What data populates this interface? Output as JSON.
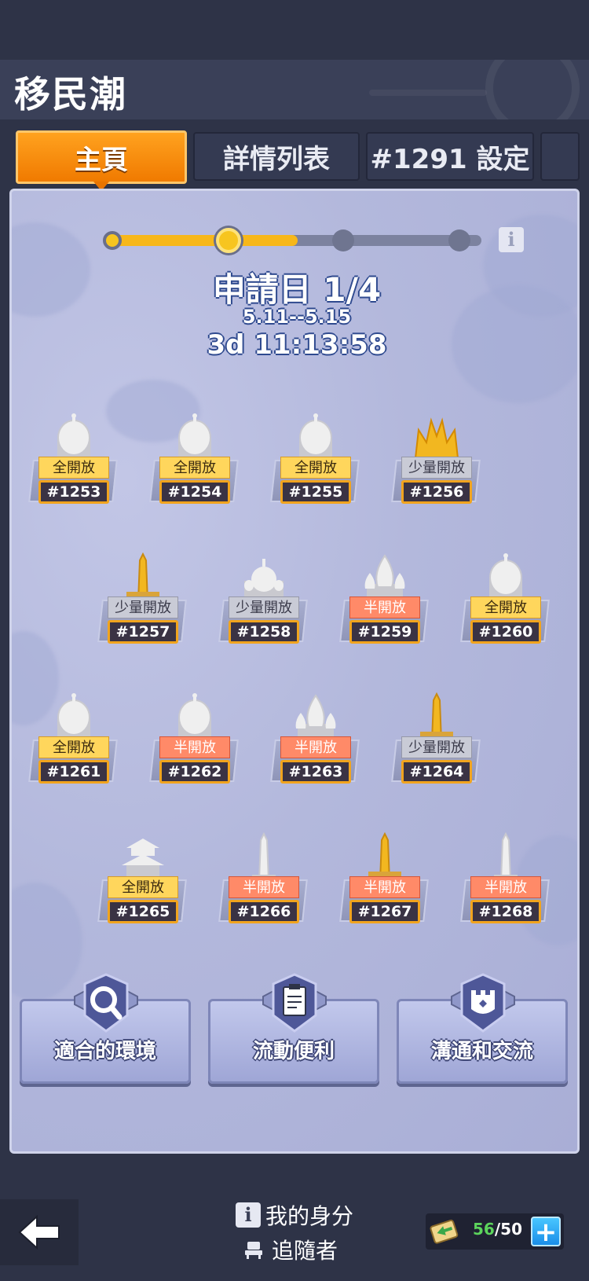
{
  "header": {
    "title": "移民潮"
  },
  "tabs": [
    {
      "label": "主頁",
      "active": true
    },
    {
      "label": "詳情列表",
      "active": false
    },
    {
      "label": "#1291 設定",
      "active": false
    },
    {
      "label": "",
      "active": false
    }
  ],
  "progress": {
    "phase_label": "申請日 1/4",
    "dates": "5.11--5.15",
    "countdown": "3d 11:13:58",
    "current_step": 2,
    "total_steps": 4,
    "fill_fraction": 0.5
  },
  "servers": [
    {
      "id": "#1253",
      "status": "全開放",
      "kind": "full",
      "building": "dome"
    },
    {
      "id": "#1254",
      "status": "全開放",
      "kind": "full",
      "building": "dome"
    },
    {
      "id": "#1255",
      "status": "全開放",
      "kind": "full",
      "building": "dome"
    },
    {
      "id": "#1256",
      "status": "少量開放",
      "kind": "few",
      "building": "crown"
    },
    {
      "id": "#1257",
      "status": "少量開放",
      "kind": "few",
      "building": "obelisk-gold"
    },
    {
      "id": "#1258",
      "status": "少量開放",
      "kind": "few",
      "building": "mosque"
    },
    {
      "id": "#1259",
      "status": "半開放",
      "kind": "half",
      "building": "onion"
    },
    {
      "id": "#1260",
      "status": "全開放",
      "kind": "full",
      "building": "dome"
    },
    {
      "id": "#1261",
      "status": "全開放",
      "kind": "full",
      "building": "dome"
    },
    {
      "id": "#1262",
      "status": "半開放",
      "kind": "half",
      "building": "dome"
    },
    {
      "id": "#1263",
      "status": "半開放",
      "kind": "half",
      "building": "onion"
    },
    {
      "id": "#1264",
      "status": "少量開放",
      "kind": "few",
      "building": "obelisk-gold"
    },
    {
      "id": "#1265",
      "status": "全開放",
      "kind": "full",
      "building": "pagoda"
    },
    {
      "id": "#1266",
      "status": "半開放",
      "kind": "half",
      "building": "obelisk"
    },
    {
      "id": "#1267",
      "status": "半開放",
      "kind": "half",
      "building": "obelisk-gold"
    },
    {
      "id": "#1268",
      "status": "半開放",
      "kind": "half",
      "building": "obelisk"
    }
  ],
  "actions": [
    {
      "label": "適合的環境",
      "icon": "magnifier-icon"
    },
    {
      "label": "流動便利",
      "icon": "clipboard-icon"
    },
    {
      "label": "溝通和交流",
      "icon": "castle-icon"
    }
  ],
  "bottom": {
    "identity_label": "我的身分",
    "role_label": "追隨者",
    "stamina_current": "56",
    "stamina_max": "/50"
  },
  "colors": {
    "accent_orange": "#f38a0a",
    "full_open": "#ffd65c",
    "half_open": "#ff8a68",
    "few_open": "#c9cbd6"
  }
}
